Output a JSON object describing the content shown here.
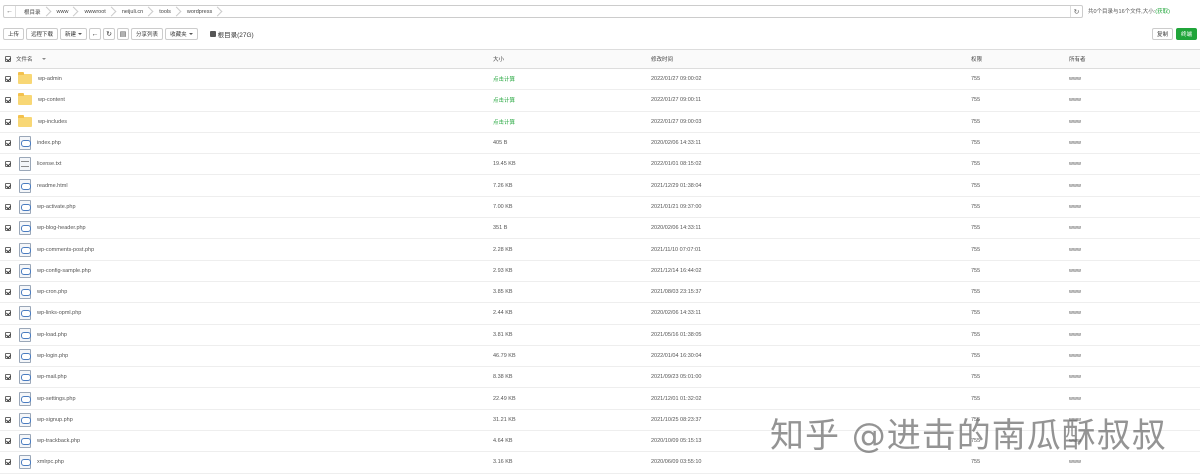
{
  "pathbar": {
    "crumbs": [
      "根目录",
      "www",
      "wwwroot",
      "neijuli.cn",
      "tools",
      "wordpress"
    ]
  },
  "summary": {
    "text": "共0个目录与16个文件,大小:",
    "link": "获取"
  },
  "toolbar": {
    "upload": "上传",
    "remote_download": "远程下载",
    "new": "新建",
    "share_list": "分享列表",
    "favorites": "收藏夹",
    "disk": "根目录(27G)",
    "paste": "复制",
    "terminal": "终端"
  },
  "table": {
    "headers": {
      "name": "文件名",
      "size": "大小",
      "mtime": "修改时间",
      "perm": "权限",
      "owner": "所有者"
    },
    "rows": [
      {
        "name": "wp-admin",
        "type": "folder",
        "size": "点击计算",
        "mtime": "2022/01/27 09:00:02",
        "perm": "755",
        "owner": "www"
      },
      {
        "name": "wp-content",
        "type": "folder",
        "size": "点击计算",
        "mtime": "2022/01/27 09:00:11",
        "perm": "755",
        "owner": "www"
      },
      {
        "name": "wp-includes",
        "type": "folder",
        "size": "点击计算",
        "mtime": "2022/01/27 09:00:03",
        "perm": "755",
        "owner": "www"
      },
      {
        "name": "index.php",
        "type": "file",
        "size": "405 B",
        "mtime": "2020/02/06 14:33:11",
        "perm": "755",
        "owner": "www"
      },
      {
        "name": "license.txt",
        "type": "text",
        "size": "19.45 KB",
        "mtime": "2022/01/01 08:15:02",
        "perm": "755",
        "owner": "www"
      },
      {
        "name": "readme.html",
        "type": "file",
        "size": "7.26 KB",
        "mtime": "2021/12/29 01:38:04",
        "perm": "755",
        "owner": "www"
      },
      {
        "name": "wp-activate.php",
        "type": "file",
        "size": "7.00 KB",
        "mtime": "2021/01/21 09:37:00",
        "perm": "755",
        "owner": "www"
      },
      {
        "name": "wp-blog-header.php",
        "type": "file",
        "size": "351 B",
        "mtime": "2020/02/06 14:33:11",
        "perm": "755",
        "owner": "www"
      },
      {
        "name": "wp-comments-post.php",
        "type": "file",
        "size": "2.28 KB",
        "mtime": "2021/11/10 07:07:01",
        "perm": "755",
        "owner": "www"
      },
      {
        "name": "wp-config-sample.php",
        "type": "file",
        "size": "2.93 KB",
        "mtime": "2021/12/14 16:44:02",
        "perm": "755",
        "owner": "www"
      },
      {
        "name": "wp-cron.php",
        "type": "file",
        "size": "3.85 KB",
        "mtime": "2021/08/03 23:15:37",
        "perm": "755",
        "owner": "www"
      },
      {
        "name": "wp-links-opml.php",
        "type": "file",
        "size": "2.44 KB",
        "mtime": "2020/02/06 14:33:11",
        "perm": "755",
        "owner": "www"
      },
      {
        "name": "wp-load.php",
        "type": "file",
        "size": "3.81 KB",
        "mtime": "2021/05/16 01:38:05",
        "perm": "755",
        "owner": "www"
      },
      {
        "name": "wp-login.php",
        "type": "file",
        "size": "46.79 KB",
        "mtime": "2022/01/04 16:30:04",
        "perm": "755",
        "owner": "www"
      },
      {
        "name": "wp-mail.php",
        "type": "file",
        "size": "8.38 KB",
        "mtime": "2021/09/23 05:01:00",
        "perm": "755",
        "owner": "www"
      },
      {
        "name": "wp-settings.php",
        "type": "file",
        "size": "22.49 KB",
        "mtime": "2021/12/01 01:32:02",
        "perm": "755",
        "owner": "www"
      },
      {
        "name": "wp-signup.php",
        "type": "file",
        "size": "31.21 KB",
        "mtime": "2021/10/25 08:23:37",
        "perm": "755",
        "owner": "www"
      },
      {
        "name": "wp-trackback.php",
        "type": "file",
        "size": "4.64 KB",
        "mtime": "2020/10/09 05:15:13",
        "perm": "755",
        "owner": "www"
      },
      {
        "name": "xmlrpc.php",
        "type": "file",
        "size": "3.16 KB",
        "mtime": "2020/06/09 03:55:10",
        "perm": "755",
        "owner": "www"
      }
    ]
  },
  "watermark": "知乎 @进击的南瓜酥叔叔",
  "colors": {
    "accent": "#20a53a",
    "folder": "#f8d775"
  }
}
